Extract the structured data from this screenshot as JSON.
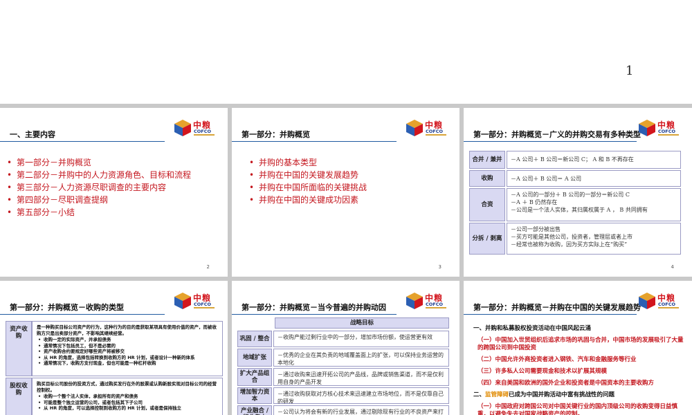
{
  "top_page": {
    "page_number": "1"
  },
  "logo": {
    "cn": "中粮",
    "en": "COFCO"
  },
  "slide2": {
    "title": "一、主要内容",
    "items": [
      "第一部分－并购概览",
      "第二部分－并购中的人力资源角色、目标和流程",
      "第三部分－人力资源尽职调查的主要内容",
      "第四部分－尽职调查提纲",
      "第五部分－小结"
    ],
    "page": "2"
  },
  "slide3": {
    "title": "第一部分：并购概览",
    "items": [
      "并购的基本类型",
      "并购在中国的关键发展趋势",
      "并购在中国所面临的关键挑战",
      "并购在中国的关键成功因素"
    ],
    "page": "3"
  },
  "slide4": {
    "title": "第一部分：并购概览－广义的并购交易有多种类型",
    "rows": [
      {
        "label": "合并 / 兼并",
        "lines": [
          "－A 公司＋ B 公司＝新公司 C； A 和 B 不再存在"
        ]
      },
      {
        "label": "收购",
        "lines": [
          "－A 公司＋ B 公司＝ A 公司"
        ]
      },
      {
        "label": "合资",
        "lines": [
          "－A 公司的一部分＋ B 公司的一部分＝新公司 C",
          "－A ＋ B 仍然存在",
          "－公司是一个法人实体，其归属权属于 A ， B 共同拥有"
        ]
      },
      {
        "label": "分拆 / 剥离",
        "lines": [
          "－公司一部分被出售",
          "－买方可能是其他公司，投资者，管理层或者上市",
          "－经常也被称为收购，因为买方实际上在“购买”"
        ]
      }
    ],
    "page": "4"
  },
  "slide5": {
    "title": "第一部分：并购概览－收购的类型",
    "asset_label": "资产收购",
    "asset_lead": "是一种购买目标公司资产的行为，这种行为的目的是获取某项具有使用价值的资产，而被收购方只是出卖部分资产，不影响其继续经营。",
    "asset_items": [
      "收购一定的实际资产，并承担债务",
      "通常情况下包括员工，但不是必需的",
      "资产收购合约要规定好哪些资产将被移交",
      "从 HR 的角度，选择包括转换到收购方的 HR 计划，或者设计一种新的体系",
      "通常情况下，收购方支付现金，但也可能是一种杠杆收购"
    ],
    "equity_label": "股权收购",
    "equity_lead": "购买目标公司股份的投资方式，通过购买发行在外的股票或认购新股实现对目标公司的经营控制权。",
    "equity_items": [
      "收购一个整个法人实体，承担所有的资产和债务",
      "可能是整个独立运营的公司，或者包括其下子公司",
      "从 HR 的角度，可以选择控制到收购方的 HR 计划，或者是保持独立"
    ]
  },
  "slide6": {
    "title": "第一部分：并购概览－当今普遍的并购动因",
    "header": "战略目标",
    "rows": [
      {
        "label": "巩固 / 整合",
        "text": "－收购产能过剩行业中的一部分，增加市场份额，使运营更有效"
      },
      {
        "label": "地域扩张",
        "text": "－优秀的企业在其负责的地域覆盖面上的扩张，可以保持业务运营的本地化"
      },
      {
        "label": "扩大产品组合",
        "text": "－通过收购来迅速开拓公司的产品线，品牌或销售渠道，而不是仅利用自身的产品开发"
      },
      {
        "label": "增加智力资本",
        "text": "－通过收购获取对方核心技术来迅速建立市场地位，而不是仅靠自己的研发"
      },
      {
        "label": "产业融合 / 行业集中",
        "text": "－公司认为将会有新的行业发展，通过剔除现有行业的不良资产来打造新的产业"
      }
    ]
  },
  "slide7": {
    "title": "第一部分：并购概览－并购在中国的关键发展趋势",
    "heading1": "一、并购和私募股权投资活动在中国风起云涌",
    "items1": [
      "（一）中国加入世贸组织后追求市场的巩固与合并，中国市场的发展吸引了大量的跨国公司到中国投资",
      "（二）中国允许外商投资者进入钢铁、汽车和金融服务等行业",
      "（三）许多私人公司需要现金和技术以扩展其规模",
      "（四）来自美国和欧洲的国外企业和投资者是中国资本的主要收购方"
    ],
    "heading2_pre": "二、",
    "heading2_hl": "监管障碍",
    "heading2_post": "已成为中国并购活动中富有挑战性的问题",
    "item2": "（一）中国政府对跨国公司对中国关键行业的国内顶级公司的收购变得日益慎重，以避免失去对国家战略资产的控制。"
  }
}
